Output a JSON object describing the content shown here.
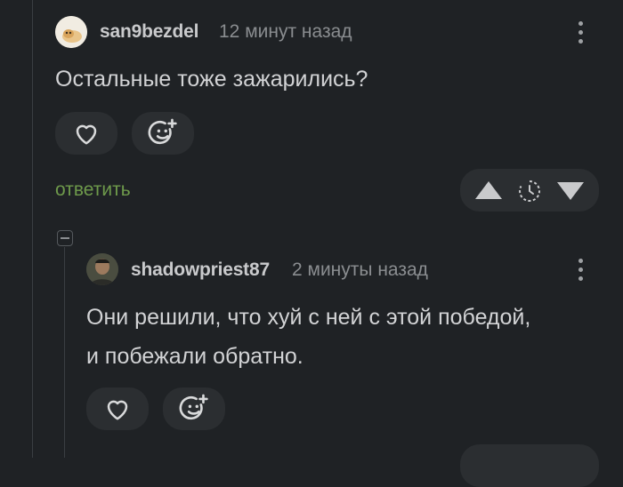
{
  "comment1": {
    "username": "san9bezdel",
    "timestamp": "12 минут назад",
    "text": "Остальные тоже зажарились?",
    "reply_label": "ответить",
    "avatar_icon": "cat-avatar",
    "like_icon": "heart-icon",
    "reaction_icon": "smiley-add-icon"
  },
  "comment2": {
    "username": "shadowpriest87",
    "timestamp": "2 минуты назад",
    "text_line1": "Они решили, что хуй с ней с этой победой,",
    "text_line2": "и побежали обратно.",
    "avatar_icon": "person-avatar",
    "like_icon": "heart-icon",
    "reaction_icon": "smiley-add-icon"
  },
  "colors": {
    "background": "#1f2225",
    "pill": "#2b2e31",
    "reply_link": "#6e9a4b",
    "text": "#d2d3d5",
    "muted": "#8a8d90"
  }
}
